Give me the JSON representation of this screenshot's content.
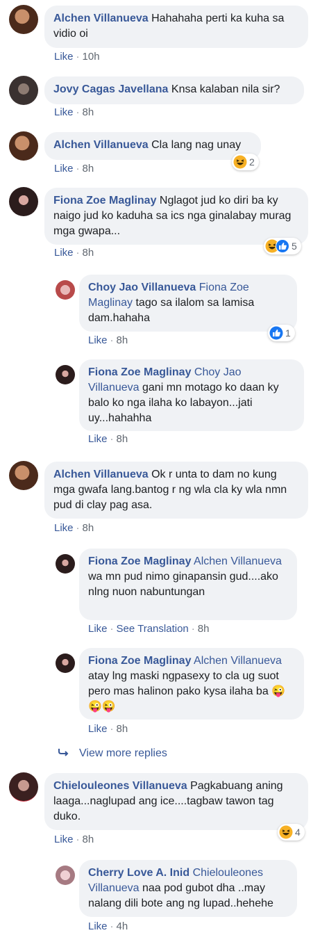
{
  "comments": [
    {
      "author": "Alchen Villanueva",
      "mention": "",
      "text": "Hahahaha perti ka kuha sa vidio oi",
      "like": "Like",
      "time": "10h",
      "reaction_count": ""
    },
    {
      "author": "Jovy Cagas Javellana",
      "mention": "",
      "text": "Knsa kalaban nila sir?",
      "like": "Like",
      "time": "8h",
      "reaction_count": ""
    },
    {
      "author": "Alchen Villanueva",
      "mention": "",
      "text": "Cla lang nag unay",
      "like": "Like",
      "time": "8h",
      "reaction_count": "2"
    },
    {
      "author": "Fiona Zoe Maglinay",
      "mention": "",
      "text": "Nglagot jud ko diri ba ky naigo jud ko kaduha sa ics nga ginalabay murag mga gwapa...",
      "like": "Like",
      "time": "8h",
      "reaction_count": "5"
    },
    {
      "author": "Choy Jao Villanueva",
      "mention": "Fiona Zoe Maglinay",
      "text": "tago sa ilalom sa lamisa dam.hahaha",
      "like": "Like",
      "time": "8h",
      "reaction_count": "1"
    },
    {
      "author": "Fiona Zoe Maglinay",
      "mention": "Choy Jao Villanueva",
      "text": "gani mn motago ko daan ky balo ko nga ilaha ko labayon...jati uy...hahahha",
      "like": "Like",
      "time": "8h",
      "reaction_count": ""
    },
    {
      "author": "Alchen Villanueva",
      "mention": "",
      "text": "Ok r unta to dam no kung mga gwafa lang.bantog r ng wla cla ky wla nmn pud di clay pag asa.",
      "like": "Like",
      "time": "8h",
      "reaction_count": ""
    },
    {
      "author": "Fiona Zoe Maglinay",
      "mention": "Alchen Villanueva",
      "text": "wa mn pud nimo ginapansin gud....ako nlng nuon nabuntungan",
      "like": "Like",
      "translation": "See Translation",
      "time": "8h",
      "reaction_count": ""
    },
    {
      "author": "Fiona Zoe Maglinay",
      "mention": "Alchen Villanueva",
      "text": "atay lng maski ngpasexy to cla ug suot pero mas halinon pako kysa ilaha ba",
      "emoji": "😜😜😜",
      "like": "Like",
      "time": "8h",
      "reaction_count": ""
    },
    {
      "author": "Chielouleones Villanueva",
      "mention": "",
      "text": "Pagkabuang aning laaga...naglupad ang ice....tagbaw tawon tag duko.",
      "like": "Like",
      "time": "8h",
      "reaction_count": "4"
    },
    {
      "author": "Cherry Love A. Inid",
      "mention": "Chielouleones Villanueva",
      "text": "naa pod gubot dha ..may nalang dili bote ang ng lupad..hehehe",
      "like": "Like",
      "time": "4h",
      "reaction_count": ""
    }
  ],
  "view_more_replies": "View more replies",
  "icons": {
    "haha": "haha-reaction-icon",
    "like": "like-reaction-icon",
    "reply_arrow": "reply-arrow-icon"
  },
  "colors": {
    "link": "#385898",
    "bubble": "#f0f2f5",
    "like_blue": "#1877f2",
    "haha_yellow": "#f7b125"
  }
}
